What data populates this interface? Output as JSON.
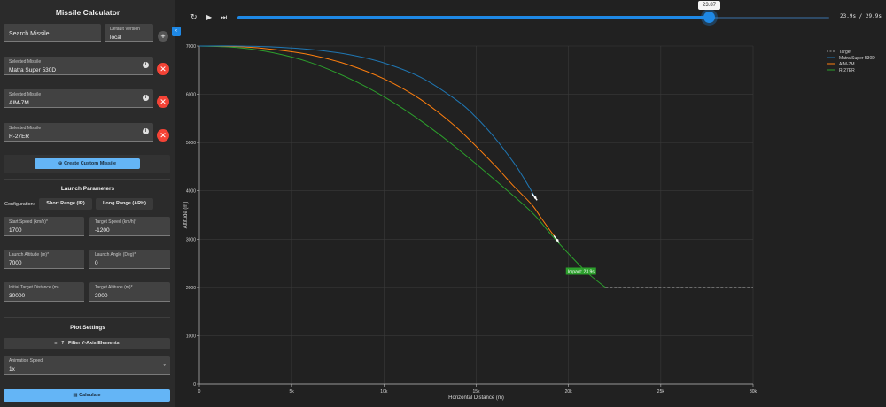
{
  "app_title": "Missile Calculator",
  "search": {
    "placeholder": "Search Missile"
  },
  "version": {
    "label": "Default Version",
    "value": "local"
  },
  "add_button": "+",
  "collapse_button": "‹",
  "info_glyph": "i",
  "remove_glyph": "✕",
  "selected_missiles": [
    {
      "label": "Selected Missile",
      "value": "Matra Super 530D"
    },
    {
      "label": "Selected Missile",
      "value": "AIM-7M"
    },
    {
      "label": "Selected Missile",
      "value": "R-27ER"
    }
  ],
  "create_button": "Create Custom Missile",
  "create_icon": "⊕",
  "launch": {
    "title": "Launch Parameters",
    "config_label": "Configuration:",
    "short_range": "Short Range (IR)",
    "long_range": "Long Range (ARH)",
    "fields": [
      {
        "label": "Start Speed (km/h)*",
        "value": "1700"
      },
      {
        "label": "Target Speed (km/h)*",
        "value": "-1200"
      },
      {
        "label": "Launch Altitude (m)*",
        "value": "7000"
      },
      {
        "label": "Launch Angle (Deg)*",
        "value": "0"
      },
      {
        "label": "Initial Target Distance (m)",
        "value": "30000"
      },
      {
        "label": "Target Altitude (m)*",
        "value": "2000"
      }
    ]
  },
  "plot_settings": {
    "title": "Plot Settings",
    "filter_button": "Filter Y-Axis Elements",
    "filter_icon": "≡",
    "help_icon": "?",
    "animation_label": "Animation Speed",
    "animation_value": "1x",
    "caret": "▾"
  },
  "calculate_button": "Calculate",
  "calculate_icon": "▦",
  "controls": {
    "restart": "↻",
    "play": "▶",
    "skip": "⏭"
  },
  "slider": {
    "value": "23.87",
    "current": 23.87,
    "max": 29.9
  },
  "time_readout": "23.9s / 29.9s",
  "colors": {
    "matra": "#1f77b4",
    "aim7": "#ff7f0e",
    "r27": "#2ca02c",
    "target": "#9a9a9a",
    "accent": "#1e88e5",
    "danger": "#f44336"
  },
  "chart_data": {
    "type": "line",
    "xlabel": "Horizontal Distance (m)",
    "ylabel": "Altitude (m)",
    "xlim": [
      0,
      30000
    ],
    "ylim": [
      0,
      7000
    ],
    "x_ticks": [
      0,
      5000,
      10000,
      15000,
      20000,
      25000,
      30000
    ],
    "x_tick_labels": [
      "0",
      "5k",
      "10k",
      "15k",
      "20k",
      "25k",
      "30k"
    ],
    "y_ticks": [
      0,
      1000,
      2000,
      3000,
      4000,
      5000,
      6000,
      7000
    ],
    "y_tick_labels": [
      "0",
      "1000",
      "2000",
      "3000",
      "4000",
      "5000",
      "6000",
      "7000"
    ],
    "grid": true,
    "legend_position": "top-right",
    "series": [
      {
        "name": "Target",
        "color": "#9a9a9a",
        "dash": true,
        "x": [
          22000,
          30000
        ],
        "y": [
          2000,
          2000
        ]
      },
      {
        "name": "Matra Super 530D",
        "color": "#1f77b4",
        "x": [
          0,
          2000,
          4000,
          6000,
          8000,
          10000,
          12000,
          14000,
          15000,
          16000,
          17000,
          17600,
          18200
        ],
        "y": [
          7000,
          7000,
          6980,
          6930,
          6830,
          6650,
          6350,
          5860,
          5520,
          5100,
          4600,
          4250,
          3860
        ]
      },
      {
        "name": "AIM-7M",
        "color": "#ff7f0e",
        "x": [
          0,
          2000,
          4000,
          6000,
          8000,
          10000,
          12000,
          14000,
          16000,
          17000,
          18000,
          18500,
          19000,
          19400
        ],
        "y": [
          7000,
          6990,
          6930,
          6820,
          6620,
          6320,
          5890,
          5290,
          4530,
          4110,
          3720,
          3450,
          3180,
          2980
        ]
      },
      {
        "name": "R-27ER",
        "color": "#2ca02c",
        "x": [
          0,
          2000,
          4000,
          6000,
          8000,
          10000,
          12000,
          14000,
          16000,
          18000,
          19000,
          20000,
          21000,
          22000
        ],
        "y": [
          7000,
          6970,
          6860,
          6660,
          6350,
          5950,
          5450,
          4870,
          4230,
          3560,
          3120,
          2700,
          2310,
          2000
        ]
      }
    ],
    "markers": [
      {
        "series": "Matra Super 530D",
        "x": 18200,
        "y": 3860
      },
      {
        "series": "AIM-7M",
        "x": 19400,
        "y": 2980
      }
    ],
    "annotations": [
      {
        "text": "Impact: 23.9s",
        "x": 21300,
        "y": 2300
      }
    ]
  }
}
